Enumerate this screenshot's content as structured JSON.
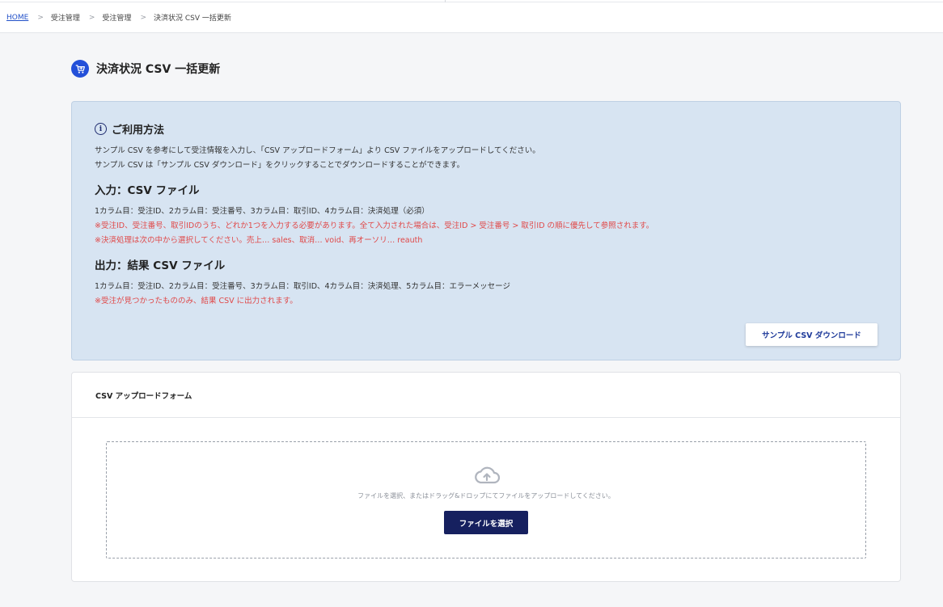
{
  "breadcrumb": {
    "home": "HOME",
    "separator": ">",
    "level1": "受注管理",
    "level2": "受注管理",
    "current": "決済状況 CSV 一括更新"
  },
  "page": {
    "title": "決済状況 CSV 一括更新",
    "icon": "cart-icon",
    "accent_color": "#2350d9"
  },
  "usage": {
    "heading": "ご利用方法",
    "line1": "サンプル CSV を参考にして受注情報を入力し、「CSV アップロードフォーム」より CSV ファイルをアップロードしてください。",
    "line2": "サンプル CSV は「サンプル CSV ダウンロード」をクリックすることでダウンロードすることができます。",
    "input_heading": "入力：CSV ファイル",
    "input_line1": "1カラム目：受注ID、2カラム目：受注番号、3カラム目：取引ID、4カラム目：決済処理（必須）",
    "input_note1": "※受注ID、受注番号、取引IDのうち、どれか1つを入力する必要があります。全て入力された場合は、受注ID > 受注番号 > 取引ID の順に優先して参照されます。",
    "input_note2": "※決済処理は次の中から選択してください。売上… sales、取消… void、再オーソリ… reauth",
    "output_heading": "出力：結果 CSV ファイル",
    "output_line1": "1カラム目：受注ID、2カラム目：受注番号、3カラム目：取引ID、4カラム目：決済処理、5カラム目：エラーメッセージ",
    "output_note1": "※受注が見つかったもののみ、結果 CSV に出力されます。",
    "sample_button": "サンプル CSV ダウンロード",
    "note_color": "#e04848"
  },
  "upload": {
    "title": "CSV アップロードフォーム",
    "dropzone_text": "ファイルを選択、またはドラッグ&ドロップにてファイルをアップロードしてください。",
    "select_button": "ファイルを選択",
    "icon": "cloud-upload-icon"
  }
}
